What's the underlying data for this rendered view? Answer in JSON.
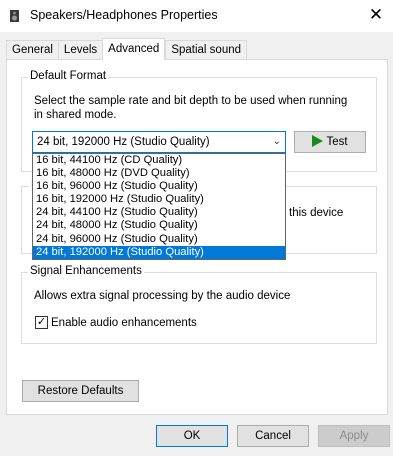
{
  "window": {
    "title": "Speakers/Headphones Properties",
    "close_glyph": "✕",
    "icon": "speaker-icon"
  },
  "tabs": [
    {
      "label": "General"
    },
    {
      "label": "Levels"
    },
    {
      "label": "Advanced"
    },
    {
      "label": "Spatial sound"
    }
  ],
  "default_format": {
    "group_label": "Default Format",
    "description_line1": "Select the sample rate and bit depth to be used when running",
    "description_line2": "in shared mode.",
    "selected_value": "24 bit, 192000 Hz (Studio Quality)",
    "test_label": "Test",
    "options": [
      "16 bit, 44100 Hz (CD Quality)",
      "16 bit, 48000 Hz (DVD Quality)",
      "16 bit, 96000 Hz (Studio Quality)",
      "16 bit, 192000 Hz (Studio Quality)",
      "24 bit, 44100 Hz (Studio Quality)",
      "24 bit, 48000 Hz (Studio Quality)",
      "24 bit, 96000 Hz (Studio Quality)",
      "24 bit, 192000 Hz (Studio Quality)"
    ]
  },
  "exclusive_mode": {
    "group_label_visible": "E",
    "partial_text": "this device"
  },
  "signal_enhancements": {
    "group_label": "Signal Enhancements",
    "description": "Allows extra signal processing by the audio device",
    "checkbox_label": "Enable audio enhancements",
    "checked": true
  },
  "buttons": {
    "restore": "Restore Defaults",
    "ok": "OK",
    "cancel": "Cancel",
    "apply": "Apply"
  },
  "colors": {
    "accent": "#0078d7",
    "play_green": "#1a8a1a"
  }
}
